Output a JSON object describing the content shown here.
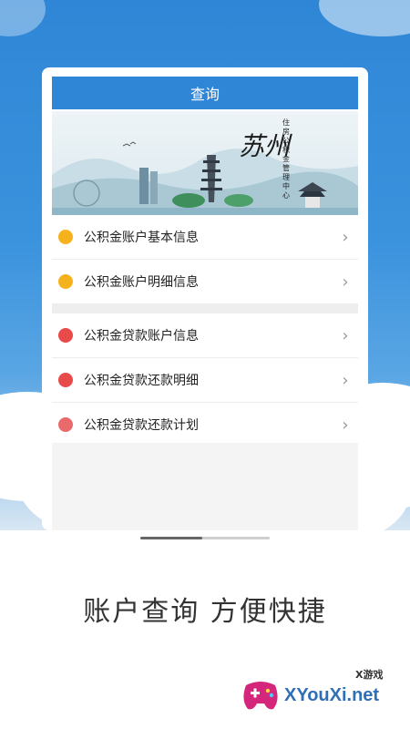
{
  "header": {
    "title": "查询"
  },
  "banner": {
    "calligraphy": "苏州",
    "org_vertical": "住房公积金管理中心"
  },
  "menu": {
    "group1": [
      {
        "label": "公积金账户基本信息",
        "icon": "coin-bag-icon",
        "color": "#f5b21d"
      },
      {
        "label": "公积金账户明细信息",
        "icon": "coin-stack-icon",
        "color": "#f5b21d"
      }
    ],
    "group2": [
      {
        "label": "公积金贷款账户信息",
        "icon": "loan-bag-icon",
        "color": "#e84a4a"
      },
      {
        "label": "公积金贷款还款明细",
        "icon": "loan-receipt-icon",
        "color": "#e84a4a"
      },
      {
        "label": "公积金贷款还款计划",
        "icon": "loan-plan-icon",
        "color": "#e86a6a"
      }
    ],
    "chevron": "›"
  },
  "slogan": "账户查询  方便快捷",
  "watermark": {
    "text": "XYouXi.net",
    "small": "X游戏"
  },
  "colors": {
    "primary": "#2f86d6",
    "accent_gold": "#f5b21d",
    "accent_red": "#e84a4a"
  }
}
